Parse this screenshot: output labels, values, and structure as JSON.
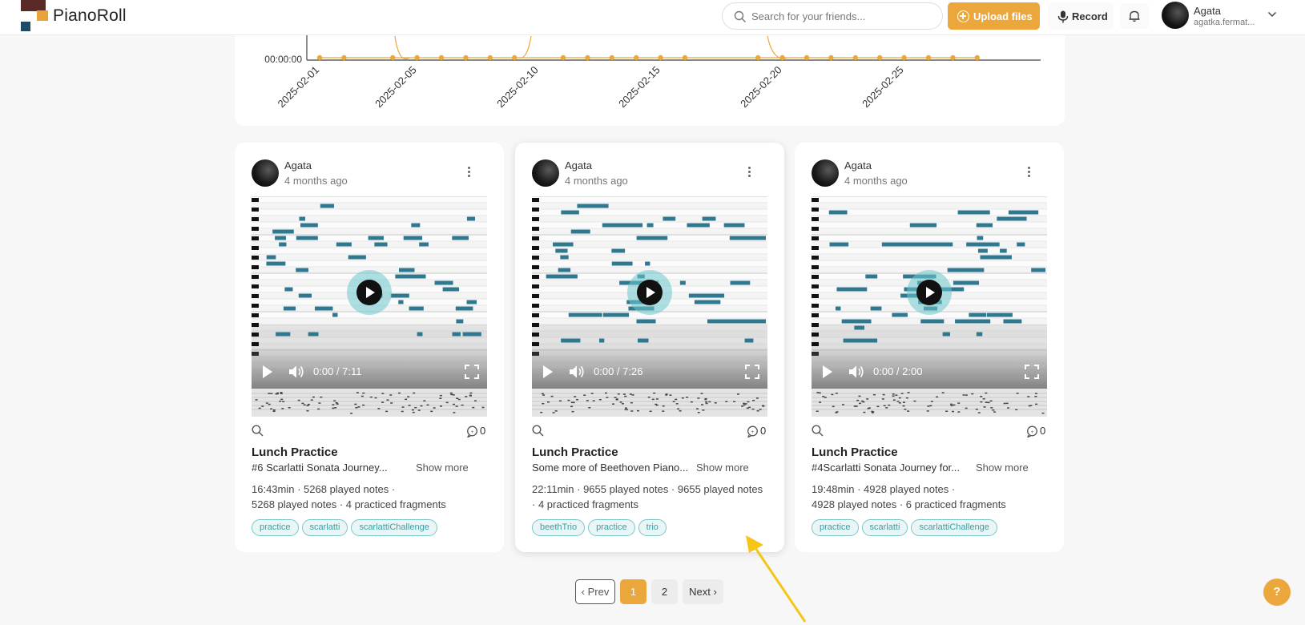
{
  "header": {
    "brand": "PianoRoll",
    "search_placeholder": "Search for your friends...",
    "upload_label": "Upload files",
    "record_label": "Record",
    "user_name": "Agata",
    "user_email": "agatka.fermat..."
  },
  "activity_chart": {
    "type": "line",
    "y_tick_visible": "00:00:00",
    "x_ticks": [
      "2025-02-01",
      "2025-02-05",
      "2025-02-10",
      "2025-02-15",
      "2025-02-20",
      "2025-02-25"
    ],
    "line_color": "#eba73c"
  },
  "cards": [
    {
      "author": "Agata",
      "time_ago": "4 months ago",
      "video_time": "0:00 / 7:11",
      "comments": "0",
      "title": "Lunch Practice",
      "description": "#6 Scarlatti Sonata Journey...",
      "show_more": "Show more",
      "stats_line1": "16:43min · 5268 played notes ·",
      "stats_line2": "5268 played notes · 4 practiced fragments",
      "tags": [
        "practice",
        "scarlatti",
        "scarlattiChallenge"
      ]
    },
    {
      "author": "Agata",
      "time_ago": "4 months ago",
      "video_time": "0:00 / 7:26",
      "comments": "0",
      "title": "Lunch Practice",
      "description": "Some more of Beethoven Piano...",
      "show_more": "Show more",
      "stats_line1": "22:11min · 9655 played notes · 9655 played notes",
      "stats_line2": "· 4 practiced fragments",
      "tags": [
        "beethTrio",
        "practice",
        "trio"
      ]
    },
    {
      "author": "Agata",
      "time_ago": "4 months ago",
      "video_time": "0:00 / 2:00",
      "comments": "0",
      "title": "Lunch Practice",
      "description": "#4Scarlatti Sonata Journey for...",
      "show_more": "Show more",
      "stats_line1": "19:48min · 4928 played notes ·",
      "stats_line2": "4928 played notes · 6 practiced fragments",
      "tags": [
        "practice",
        "scarlatti",
        "scarlattiChallenge"
      ]
    }
  ],
  "pagination": {
    "prev": "‹ Prev",
    "pages": [
      "1",
      "2"
    ],
    "current": "1",
    "next": "Next ›"
  },
  "help_label": "?",
  "colors": {
    "accent": "#eba73c",
    "note": "#2f7890",
    "tag_border": "#7ac7c9"
  }
}
